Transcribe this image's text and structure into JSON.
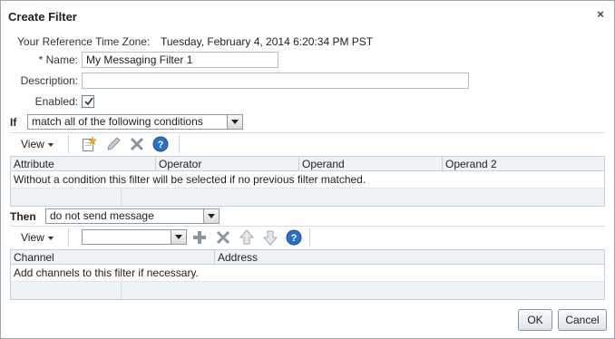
{
  "dialog": {
    "title": "Create Filter",
    "close_glyph": "×"
  },
  "form": {
    "timezone_label": "Your Reference Time Zone:",
    "timezone_value": "Tuesday, February 4, 2014 6:20:34 PM PST",
    "name_label": "* Name:",
    "name_value": "My Messaging Filter 1",
    "description_label": "Description:",
    "description_value": "",
    "enabled_label": "Enabled:",
    "enabled_checked": true
  },
  "if_section": {
    "label": "If",
    "match_value": "match all of the following conditions",
    "view_label": "View",
    "toolbar_icons": [
      "new-icon",
      "edit-pencil-icon",
      "delete-x-icon",
      "help-icon"
    ],
    "columns": [
      "Attribute",
      "Operator",
      "Operand",
      "Operand 2"
    ],
    "empty_text": "Without a condition this filter will be selected if no previous filter matched."
  },
  "then_section": {
    "label": "Then",
    "action_value": "do not send message",
    "view_label": "View",
    "channel_select_value": "",
    "toolbar_icons": [
      "add-plus-icon",
      "delete-x-icon",
      "move-up-icon",
      "move-down-icon",
      "help-icon"
    ],
    "columns": [
      "Channel",
      "Address"
    ],
    "empty_text": "Add channels to this filter if necessary."
  },
  "buttons": {
    "ok": "OK",
    "cancel": "Cancel"
  },
  "colors": {
    "accent_blue": "#2a6fc9",
    "header_bg": "#eef3f8",
    "border": "#c5d0da"
  }
}
